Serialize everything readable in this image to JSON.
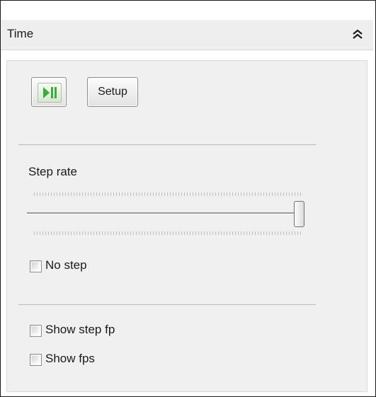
{
  "panel": {
    "title": "Time",
    "collapse_icon": "double-chevron-up-icon"
  },
  "toolbar": {
    "play_pause_icon": "play-pause-icon",
    "setup_label": "Setup"
  },
  "step_rate": {
    "label": "Step rate",
    "slider_value_fraction": 1.0
  },
  "options": {
    "no_step": {
      "label": "No step",
      "checked": false
    },
    "show_step_fps": {
      "label": "Show step fp",
      "checked": false
    },
    "show_fps": {
      "label": "Show fps",
      "checked": false
    }
  },
  "colors": {
    "play_icon": "#3cab3c",
    "panel_background": "#f0f0f0"
  }
}
